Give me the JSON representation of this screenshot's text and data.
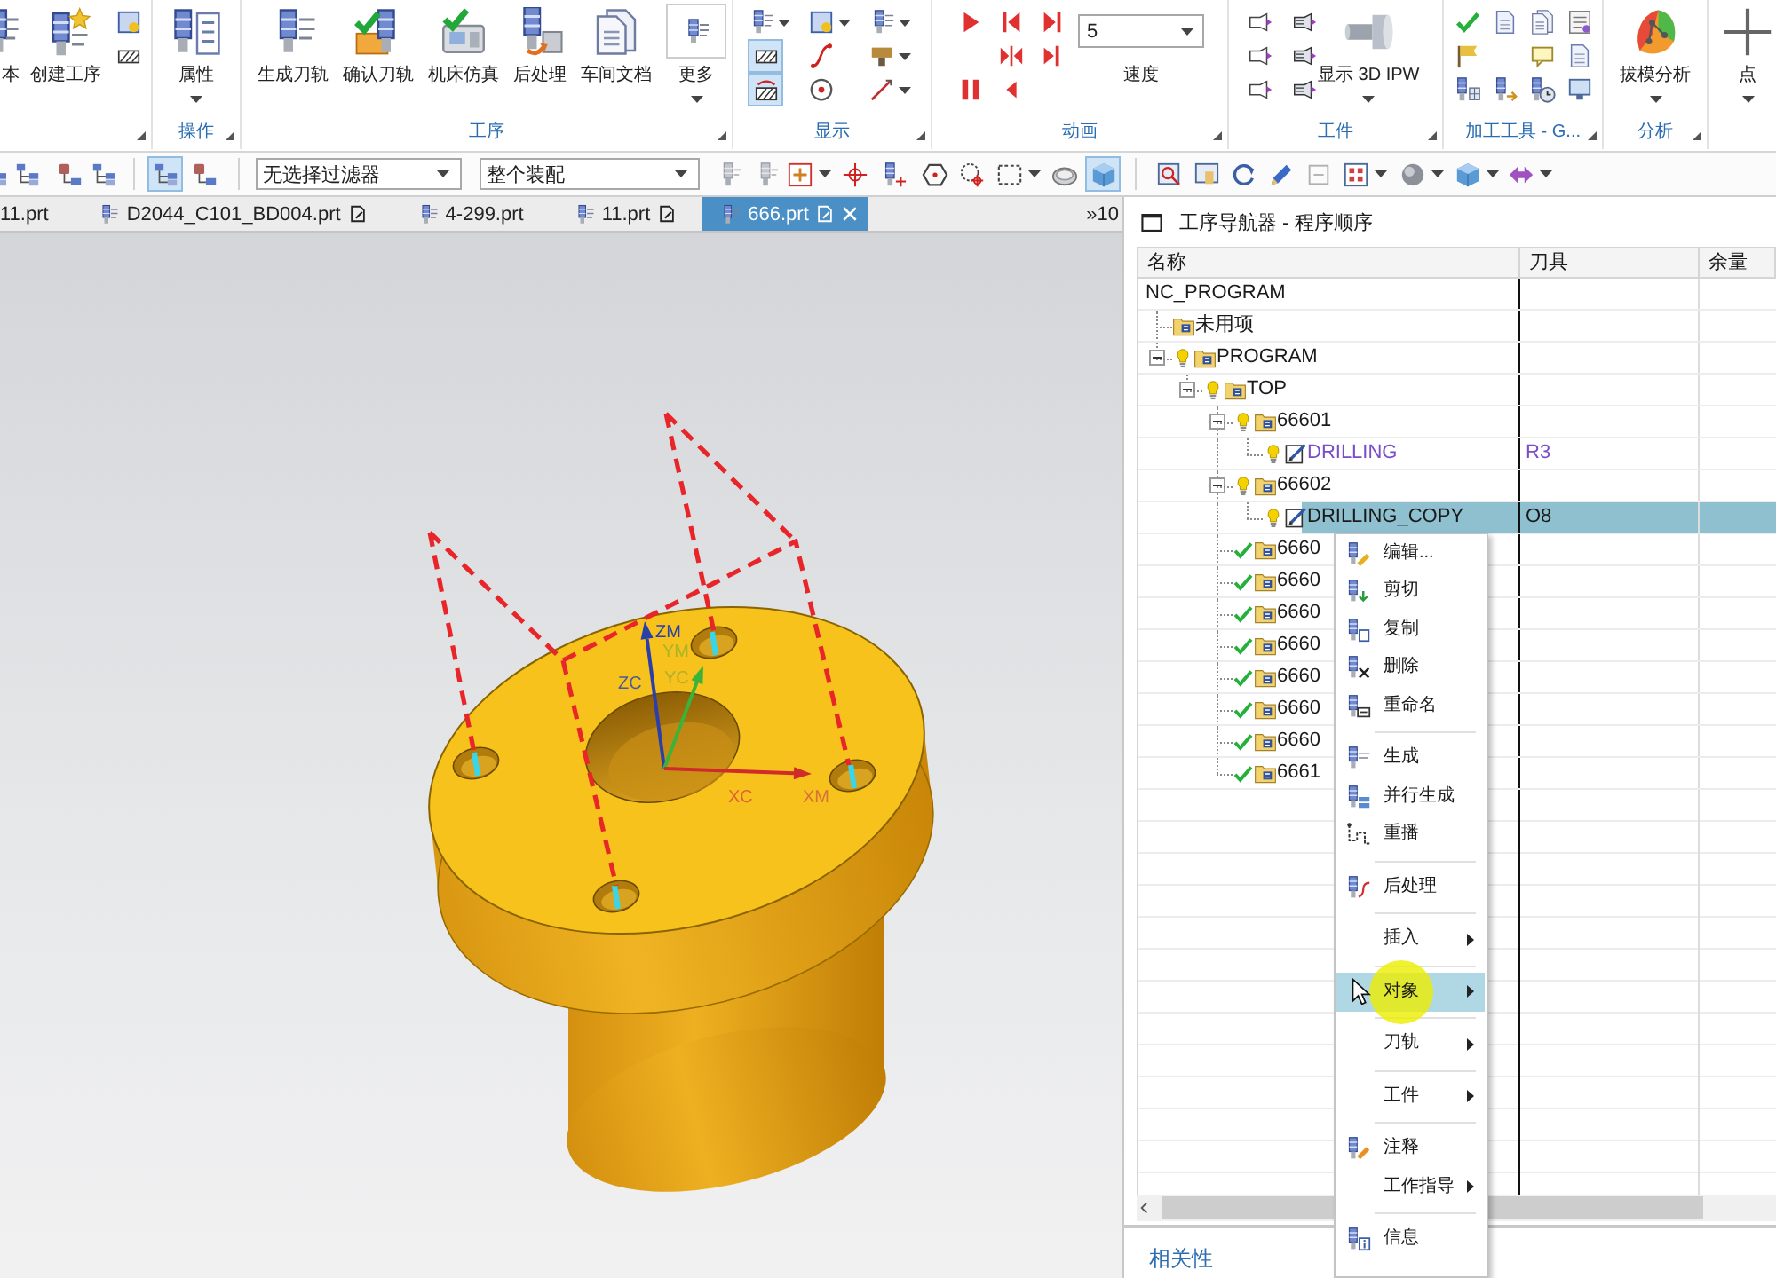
{
  "ribbon": {
    "groups": [
      {
        "launcher": true,
        "items": [
          {
            "kind": "large",
            "label": "本",
            "dropdown": false
          },
          {
            "kind": "large",
            "label": "创建工序",
            "dropdown": false
          },
          {
            "kind": "icon_grid"
          }
        ]
      },
      {
        "label": "操作",
        "launcher": true,
        "items": [
          {
            "kind": "large",
            "label": "属性",
            "dropdown": true
          }
        ]
      },
      {
        "label": "工序",
        "launcher": true,
        "items": [
          {
            "kind": "large",
            "label": "生成刀轨",
            "dropdown": false
          },
          {
            "kind": "large",
            "label": "确认刀轨",
            "dropdown": false
          },
          {
            "kind": "large",
            "label": "机床仿真",
            "dropdown": false
          },
          {
            "kind": "large",
            "label": "后处理",
            "dropdown": false
          },
          {
            "kind": "large",
            "label": "车间文档",
            "dropdown": false
          },
          {
            "kind": "boxed",
            "label": "更多",
            "dropdown": true
          }
        ]
      },
      {
        "label": "显示",
        "launcher": true,
        "items": [
          {
            "kind": "icon_grid",
            "toggles": [
              {
                "on": true
              },
              {
                "on": true
              }
            ]
          }
        ]
      },
      {
        "label": "动画",
        "launcher": true,
        "items": [
          {
            "kind": "icon_grid"
          },
          {
            "kind": "speed",
            "value": "5",
            "label": "速度"
          }
        ]
      },
      {
        "label": "工件",
        "launcher": true,
        "items": [
          {
            "kind": "icon_grid"
          },
          {
            "kind": "large",
            "label": "显示 3D IPW",
            "dropdown": true
          }
        ]
      },
      {
        "label": "加工工具 - G...",
        "launcher": true,
        "items": [
          {
            "kind": "icon_grid"
          }
        ]
      },
      {
        "label": "分析",
        "launcher": true,
        "items": [
          {
            "kind": "large",
            "label": "拔模分析",
            "dropdown": true
          }
        ]
      },
      {
        "launcher": false,
        "items": [
          {
            "kind": "large",
            "label": "点",
            "dropdown": true
          }
        ]
      }
    ]
  },
  "toolbar": {
    "selection_filter": "无选择过滤器",
    "assembly_scope": "整个装配",
    "toggles": [
      {
        "on": true
      },
      {
        "on": false
      },
      {
        "on": true
      }
    ]
  },
  "tabs": [
    {
      "label": "11.prt",
      "selected": false,
      "clipped": true,
      "modified": false
    },
    {
      "label": "D2044_C101_BD004.prt",
      "selected": false,
      "clipped": false,
      "modified": true
    },
    {
      "label": "4-299.prt",
      "selected": false,
      "clipped": false,
      "modified": false
    },
    {
      "label": "11.prt",
      "selected": false,
      "clipped": false,
      "modified": true
    },
    {
      "label": "666.prt",
      "selected": true,
      "clipped": false,
      "modified": true
    }
  ],
  "tabs_overflow": "»10",
  "viewport": {
    "axis_labels": [
      {
        "text": "ZM",
        "color": "#2b3fa8"
      },
      {
        "text": "YM",
        "color": "#a6b528"
      },
      {
        "text": "ZC",
        "color": "#4a5a9a"
      },
      {
        "text": "YC",
        "color": "#b0b030"
      },
      {
        "text": "XC",
        "color": "#e0603a"
      },
      {
        "text": "XM",
        "color": "#d8703a"
      }
    ]
  },
  "navigator": {
    "title": "工序导航器 - 程序顺序",
    "columns": [
      "名称",
      "刀具",
      "余量"
    ],
    "tree": [
      {
        "name": "NC_PROGRAM",
        "selected": false,
        "color": "#1a1a1a",
        "children": [
          {
            "name": "未用项",
            "kind": "program",
            "selected": false,
            "color": "#1a1a1a"
          },
          {
            "name": "PROGRAM",
            "kind": "program",
            "complete": false,
            "expanded": true,
            "selected": false,
            "color": "#1a1a1a",
            "children": [
              {
                "name": "TOP",
                "kind": "program",
                "complete": false,
                "expanded": true,
                "selected": false,
                "color": "#1a1a1a",
                "children": [
                  {
                    "name": "66601",
                    "kind": "program",
                    "complete": false,
                    "expanded": true,
                    "selected": false,
                    "color": "#1a1a1a",
                    "children": [
                      {
                        "name": "DRILLING",
                        "kind": "operation",
                        "complete": false,
                        "tool": "R3",
                        "selected": false,
                        "color": "#7a4cc8"
                      }
                    ]
                  },
                  {
                    "name": "66602",
                    "kind": "program",
                    "complete": false,
                    "expanded": true,
                    "selected": false,
                    "color": "#1a1a1a",
                    "children": [
                      {
                        "name": "DRILLING_COPY",
                        "kind": "operation",
                        "complete": false,
                        "tool": "O8",
                        "selected": true,
                        "color": "#1a1a1a"
                      }
                    ]
                  },
                  {
                    "name": "6660",
                    "kind": "program",
                    "complete": true,
                    "selected": false,
                    "color": "#1a1a1a"
                  },
                  {
                    "name": "6660",
                    "kind": "program",
                    "complete": true,
                    "selected": false,
                    "color": "#1a1a1a"
                  },
                  {
                    "name": "6660",
                    "kind": "program",
                    "complete": true,
                    "selected": false,
                    "color": "#1a1a1a"
                  },
                  {
                    "name": "6660",
                    "kind": "program",
                    "complete": true,
                    "selected": false,
                    "color": "#1a1a1a"
                  },
                  {
                    "name": "6660",
                    "kind": "program",
                    "complete": true,
                    "selected": false,
                    "color": "#1a1a1a"
                  },
                  {
                    "name": "6660",
                    "kind": "program",
                    "complete": true,
                    "selected": false,
                    "color": "#1a1a1a"
                  },
                  {
                    "name": "6660",
                    "kind": "program",
                    "complete": true,
                    "selected": false,
                    "color": "#1a1a1a"
                  },
                  {
                    "name": "6661",
                    "kind": "program",
                    "complete": true,
                    "selected": false,
                    "color": "#1a1a1a"
                  }
                ]
              }
            ]
          }
        ]
      }
    ],
    "footer": "相关性"
  },
  "context_menu": {
    "items": [
      {
        "kind": "item",
        "label": "编辑...",
        "submenu": false,
        "selected": false
      },
      {
        "kind": "item",
        "label": "剪切",
        "submenu": false,
        "selected": false
      },
      {
        "kind": "item",
        "label": "复制",
        "submenu": false,
        "selected": false
      },
      {
        "kind": "item",
        "label": "删除",
        "submenu": false,
        "selected": false
      },
      {
        "kind": "item",
        "label": "重命名",
        "submenu": false,
        "selected": false
      },
      {
        "kind": "separator"
      },
      {
        "kind": "item",
        "label": "生成",
        "submenu": false,
        "selected": false
      },
      {
        "kind": "item",
        "label": "并行生成",
        "submenu": false,
        "selected": false
      },
      {
        "kind": "item",
        "label": "重播",
        "submenu": false,
        "selected": false
      },
      {
        "kind": "separator"
      },
      {
        "kind": "item",
        "label": "后处理",
        "submenu": false,
        "selected": false
      },
      {
        "kind": "separator"
      },
      {
        "kind": "item",
        "label": "插入",
        "submenu": true,
        "selected": false
      },
      {
        "kind": "separator"
      },
      {
        "kind": "item",
        "label": "对象",
        "submenu": true,
        "selected": true
      },
      {
        "kind": "separator"
      },
      {
        "kind": "item",
        "label": "刀轨",
        "submenu": true,
        "selected": false
      },
      {
        "kind": "separator"
      },
      {
        "kind": "item",
        "label": "工件",
        "submenu": true,
        "selected": false
      },
      {
        "kind": "separator"
      },
      {
        "kind": "item",
        "label": "注释",
        "submenu": false,
        "selected": false
      },
      {
        "kind": "item",
        "label": "工作指导",
        "submenu": true,
        "selected": false
      },
      {
        "kind": "separator"
      },
      {
        "kind": "item",
        "label": "信息",
        "submenu": false,
        "selected": false
      }
    ]
  }
}
